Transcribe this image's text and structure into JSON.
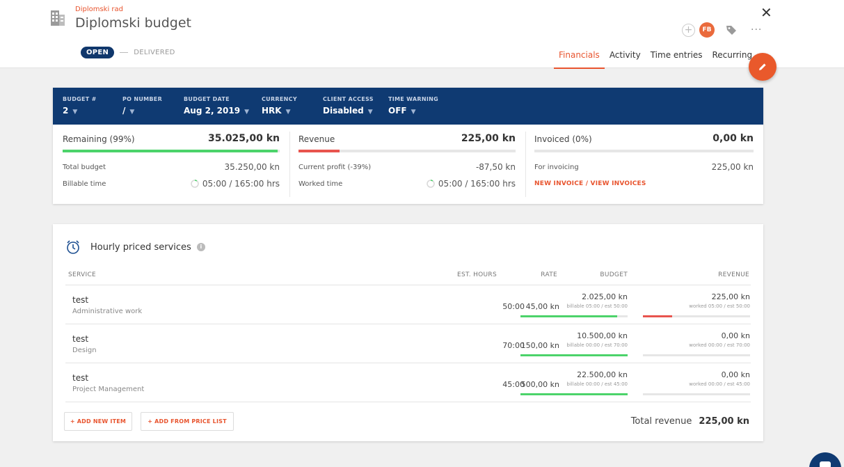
{
  "header": {
    "project_name": "Diplomski rad",
    "budget_title": "Diplomski budget",
    "status_open": "OPEN",
    "status_delivered": "DELIVERED",
    "avatar_initials": "FB",
    "tabs": [
      "Financials",
      "Activity",
      "Time entries",
      "Recurring"
    ],
    "active_tab": "Financials",
    "accent_color": "#e8542e",
    "nav_color": "#0f3a72"
  },
  "budget_bar": {
    "fields": [
      {
        "label": "BUDGET #",
        "value": "2"
      },
      {
        "label": "PO NUMBER",
        "value": "/"
      },
      {
        "label": "BUDGET DATE",
        "value": "Aug 2, 2019"
      },
      {
        "label": "CURRENCY",
        "value": "HRK"
      },
      {
        "label": "CLIENT ACCESS",
        "value": "Disabled"
      },
      {
        "label": "TIME WARNING",
        "value": "OFF"
      }
    ]
  },
  "stats": {
    "remaining": {
      "label": "Remaining (99%)",
      "value": "35.025,00 kn",
      "progress": 0.99,
      "rows": [
        {
          "label": "Total budget",
          "value": "35.250,00 kn"
        },
        {
          "label": "Billable time",
          "value": "05:00 / 165:00 hrs"
        }
      ]
    },
    "revenue": {
      "label": "Revenue",
      "value": "225,00 kn",
      "progress": 0.19,
      "rows": [
        {
          "label": "Current profit (-39%)",
          "value": "-87,50 kn"
        },
        {
          "label": "Worked time",
          "value": "05:00 / 165:00 hrs"
        }
      ]
    },
    "invoiced": {
      "label": "Invoiced (0%)",
      "value": "0,00 kn",
      "progress": 0,
      "rows": [
        {
          "label": "For invoicing",
          "value": "225,00 kn"
        }
      ],
      "link_new": "NEW INVOICE",
      "link_sep": " / ",
      "link_view": "VIEW INVOICES"
    }
  },
  "services": {
    "title": "Hourly priced services",
    "columns": [
      "SERVICE",
      "EST. HOURS",
      "RATE",
      "BUDGET",
      "REVENUE"
    ],
    "rows": [
      {
        "name": "test",
        "desc": "Administrative work",
        "hours": "50:00",
        "rate": "45,00 kn",
        "budget": "2.025,00 kn",
        "budget_sub": "billable 05:00 / est 50:00",
        "budget_progress": 0.9,
        "revenue": "225,00 kn",
        "revenue_sub": "worked 05:00 / est 50:00",
        "revenue_progress": 0.27
      },
      {
        "name": "test",
        "desc": "Design",
        "hours": "70:00",
        "rate": "150,00 kn",
        "budget": "10.500,00 kn",
        "budget_sub": "billable 00:00 / est 70:00",
        "budget_progress": 1.0,
        "revenue": "0,00 kn",
        "revenue_sub": "worked 00:00 / est 70:00",
        "revenue_progress": 0
      },
      {
        "name": "test",
        "desc": "Project Management",
        "hours": "45:00",
        "rate": "500,00 kn",
        "budget": "22.500,00 kn",
        "budget_sub": "billable 00:00 / est 45:00",
        "budget_progress": 1.0,
        "revenue": "0,00 kn",
        "revenue_sub": "worked 00:00 / est 45:00",
        "revenue_progress": 0
      }
    ],
    "add_item_label": "+ ADD NEW ITEM",
    "add_price_label": "+ ADD FROM PRICE LIST",
    "total_label": "Total revenue",
    "total_value": "225,00 kn"
  }
}
